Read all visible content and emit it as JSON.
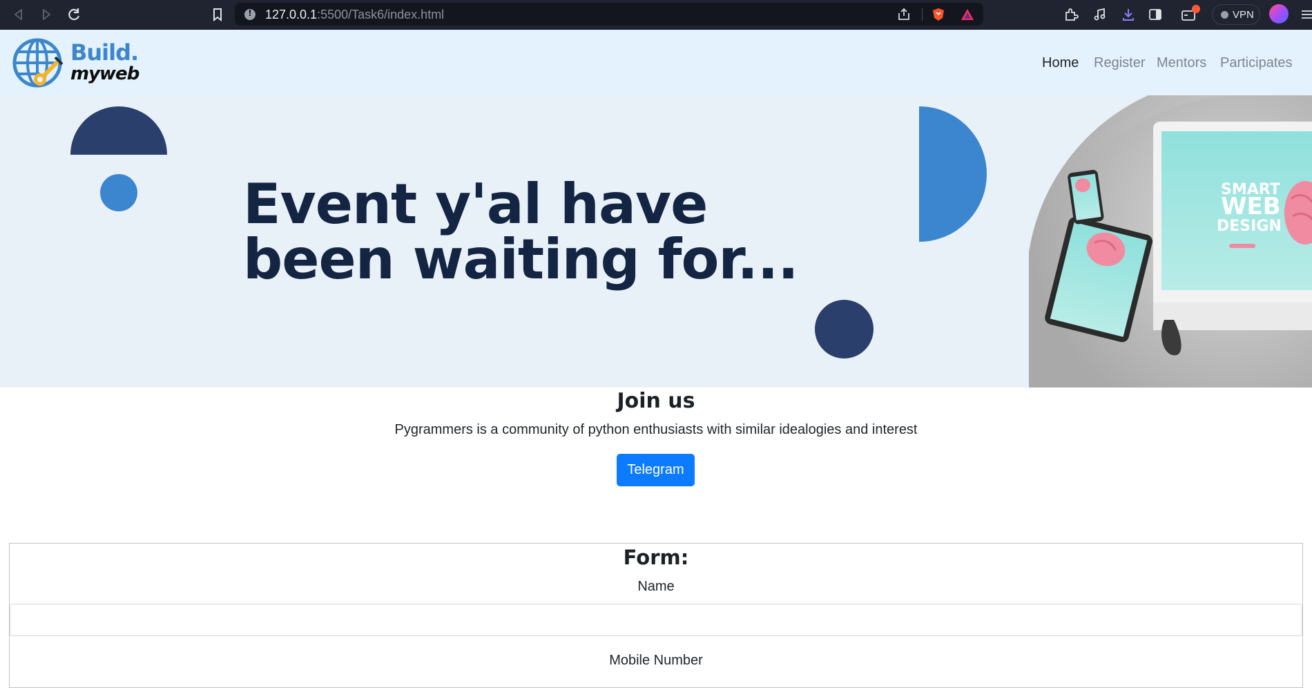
{
  "browser": {
    "url_host": "127.0.0.1",
    "url_path": ":5500/Task6/index.html",
    "vpn_label": "VPN",
    "icons": [
      "back-icon",
      "forward-icon",
      "reload-icon",
      "bookmark-icon",
      "site-info-icon",
      "share-icon",
      "brave-shield-icon",
      "brave-rewards-icon",
      "extensions-icon",
      "media-icon",
      "download-icon",
      "sidebar-icon",
      "wallet-icon",
      "profile-avatar",
      "menu-icon"
    ]
  },
  "nav": {
    "brand_line1": "Build.",
    "brand_line2": "myweb",
    "links": [
      "Home",
      "Register",
      "Mentors",
      "Participates"
    ],
    "active": "Home"
  },
  "hero": {
    "title": "Event y'al have been waiting for...",
    "image_text_line1": "SMART",
    "image_text_line2": "WEB",
    "image_text_line3": "DESIGN"
  },
  "join": {
    "heading": "Join us",
    "description": "Pygrammers is a community of python enthusiasts with similar idealogies and interest",
    "button_label": "Telegram"
  },
  "form": {
    "title": "Form:",
    "name_label": "Name",
    "name_value": "",
    "mobile_label": "Mobile Number"
  },
  "colors": {
    "nav_bg": "#e3f2fd",
    "hero_bg": "#e9f1f8",
    "navy": "#2a3f6b",
    "accent_blue": "#3b86cf",
    "button_blue": "#0d7bff"
  }
}
